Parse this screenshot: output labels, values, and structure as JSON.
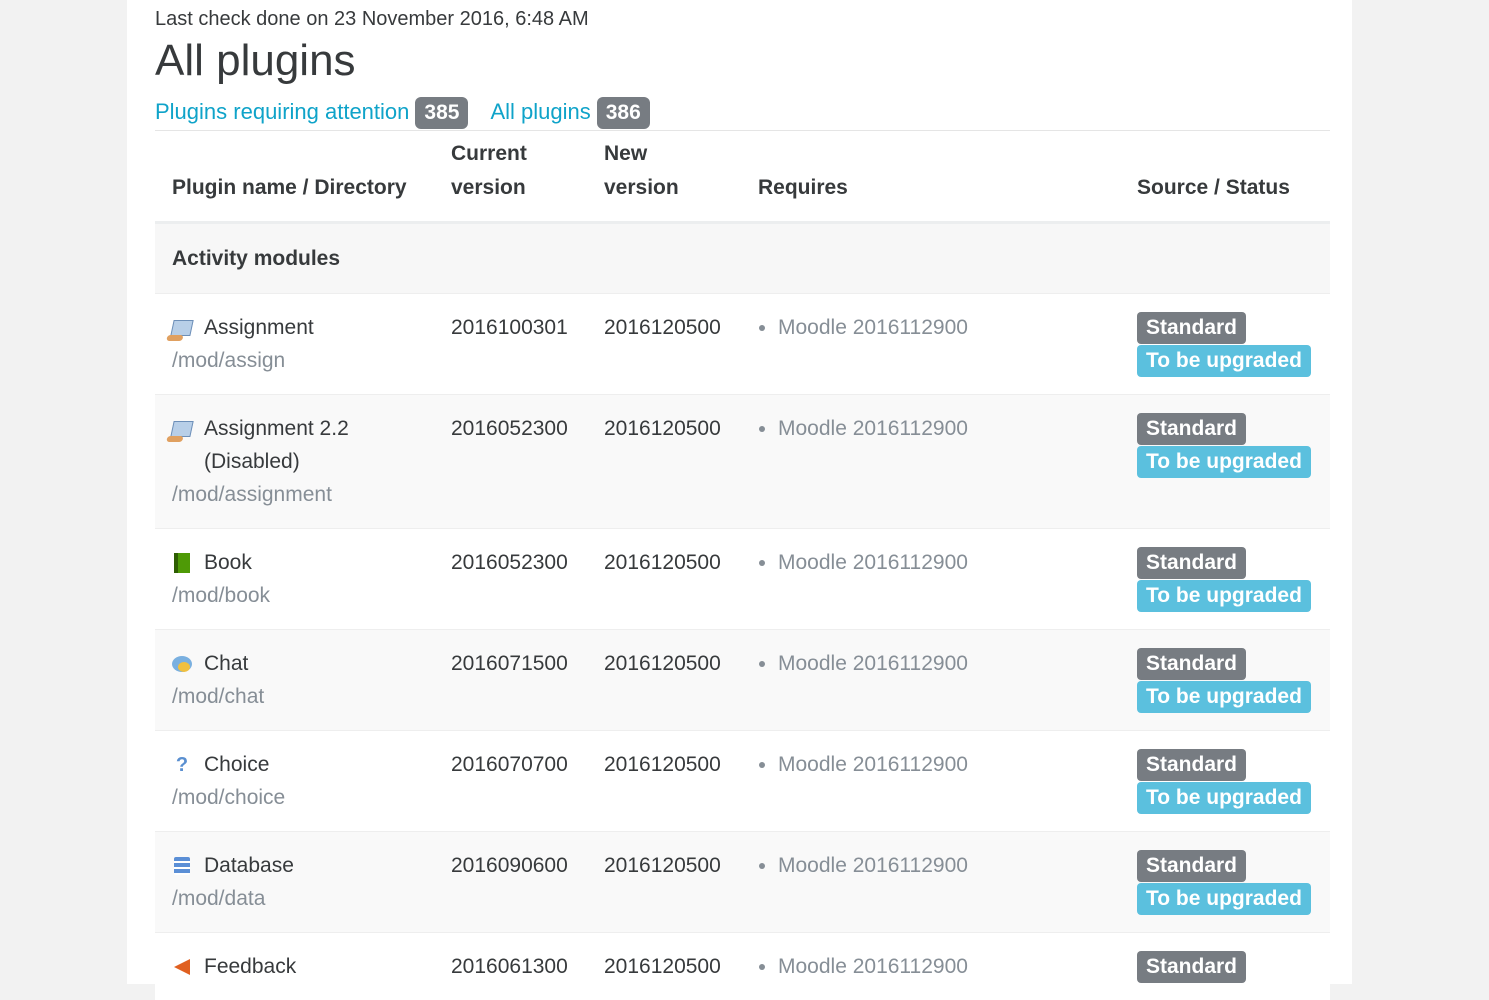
{
  "last_check": "Last check done on 23 November 2016, 6:48 AM",
  "page_title": "All plugins",
  "filters": [
    {
      "label": "Plugins requiring attention",
      "count": "385"
    },
    {
      "label": "All plugins",
      "count": "386"
    }
  ],
  "table": {
    "headers": {
      "name": "Plugin name / Directory",
      "current_line1": "Current",
      "current_line2": "version",
      "new_line1": "New",
      "new_line2": "version",
      "requires": "Requires",
      "source": "Source / Status"
    },
    "section": "Activity modules",
    "rows": [
      {
        "icon": "assignment-icon",
        "name": "Assignment",
        "dir": "/mod/assign",
        "current": "2016100301",
        "new": "2016120500",
        "requires": "Moodle 2016112900",
        "source": "Standard",
        "status": "To be upgraded"
      },
      {
        "icon": "assignment-icon",
        "name": "Assignment 2.2 (Disabled)",
        "dir": "/mod/assignment",
        "current": "2016052300",
        "new": "2016120500",
        "requires": "Moodle 2016112900",
        "source": "Standard",
        "status": "To be upgraded"
      },
      {
        "icon": "book-icon",
        "name": "Book",
        "dir": "/mod/book",
        "current": "2016052300",
        "new": "2016120500",
        "requires": "Moodle 2016112900",
        "source": "Standard",
        "status": "To be upgraded"
      },
      {
        "icon": "chat-icon",
        "name": "Chat",
        "dir": "/mod/chat",
        "current": "2016071500",
        "new": "2016120500",
        "requires": "Moodle 2016112900",
        "source": "Standard",
        "status": "To be upgraded"
      },
      {
        "icon": "choice-icon",
        "name": "Choice",
        "dir": "/mod/choice",
        "current": "2016070700",
        "new": "2016120500",
        "requires": "Moodle 2016112900",
        "source": "Standard",
        "status": "To be upgraded"
      },
      {
        "icon": "database-icon",
        "name": "Database",
        "dir": "/mod/data",
        "current": "2016090600",
        "new": "2016120500",
        "requires": "Moodle 2016112900",
        "source": "Standard",
        "status": "To be upgraded"
      },
      {
        "icon": "feedback-icon",
        "name": "Feedback",
        "dir": "",
        "current": "2016061300",
        "new": "2016120500",
        "requires": "Moodle 2016112900",
        "source": "Standard",
        "status": ""
      }
    ]
  }
}
